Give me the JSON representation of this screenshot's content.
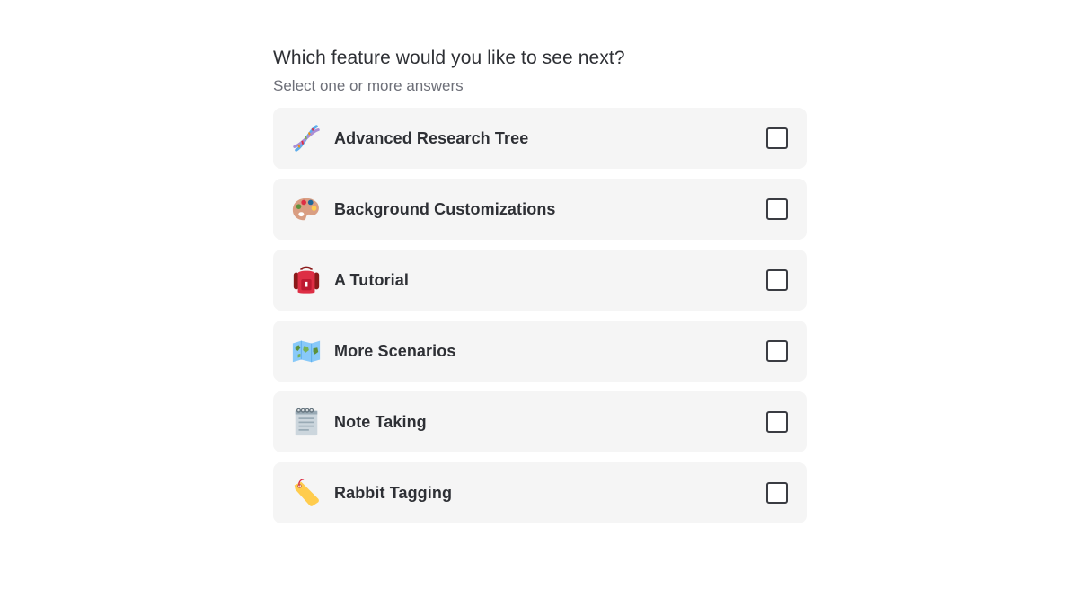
{
  "poll": {
    "question": "Which feature would you like to see next?",
    "subtitle": "Select one or more answers",
    "options": [
      {
        "label": "Advanced Research Tree",
        "icon": "dna-icon",
        "checked": false
      },
      {
        "label": "Background Customizations",
        "icon": "artist-palette-icon",
        "checked": false
      },
      {
        "label": "A Tutorial",
        "icon": "backpack-icon",
        "checked": false
      },
      {
        "label": "More Scenarios",
        "icon": "world-map-icon",
        "checked": false
      },
      {
        "label": "Note Taking",
        "icon": "spiral-notepad-icon",
        "checked": false
      },
      {
        "label": "Rabbit Tagging",
        "icon": "label-tag-icon",
        "checked": false
      }
    ]
  }
}
